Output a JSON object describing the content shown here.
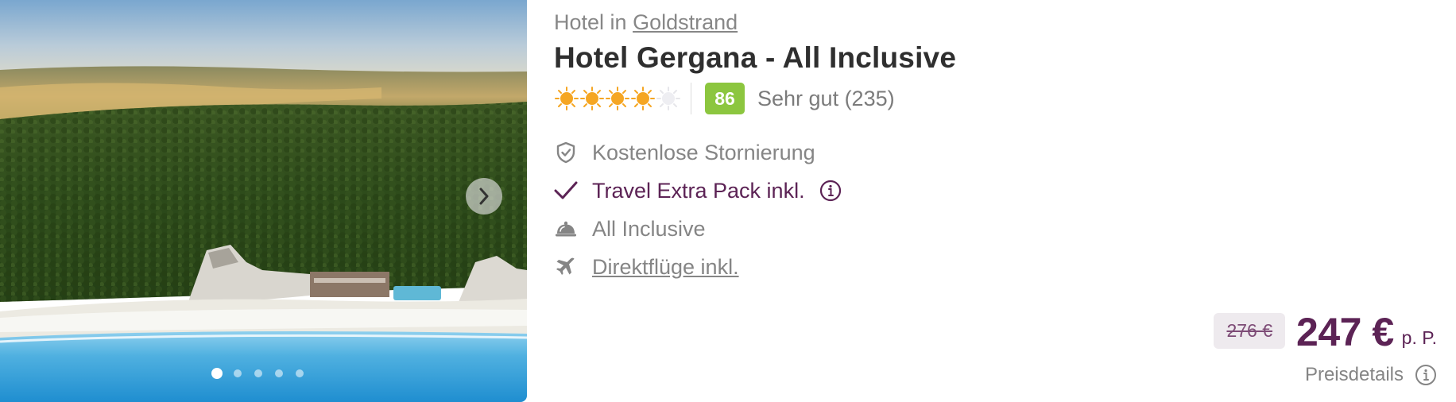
{
  "hotel": {
    "location_prefix": "Hotel in",
    "location_link": "Goldstrand",
    "name": "Hotel Gergana - All Inclusive"
  },
  "rating": {
    "stars_filled": 4,
    "stars_total": 5,
    "score": "86",
    "text": "Sehr gut (235)",
    "score_color": "#8cc63f",
    "star_color": "#f5a623"
  },
  "gallery": {
    "current_slide": 1,
    "slide_count": 5,
    "next_icon": "chevron-right-icon"
  },
  "features": [
    {
      "icon": "shield-check-icon",
      "label": "Kostenlose Stornierung"
    },
    {
      "icon": "checkmark-icon",
      "label": "Travel Extra Pack inkl."
    },
    {
      "icon": "cloche-icon",
      "label": "All Inclusive"
    },
    {
      "icon": "airplane-icon",
      "label": "Direktflüge inkl."
    }
  ],
  "price": {
    "old": "276 €",
    "current": "247 €",
    "unit": "p. P.",
    "details_label": "Preisdetails"
  },
  "colors": {
    "accent": "#5c2355",
    "muted_text": "#858585"
  }
}
